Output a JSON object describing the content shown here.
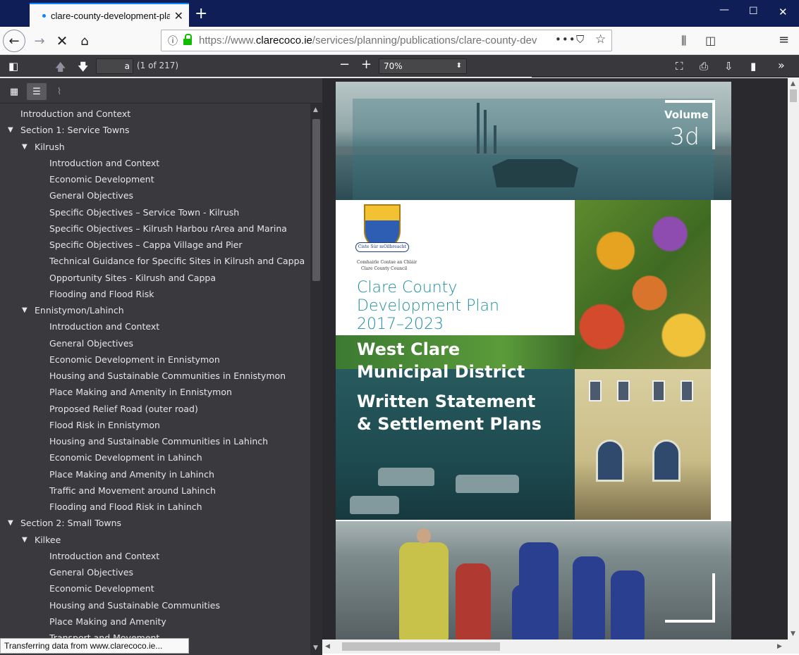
{
  "browser": {
    "tab_title": "clare-county-development-plan",
    "url_host_prefix": "https://www.",
    "url_host": "clarecoco.ie",
    "url_path": "/services/planning/publications/clare-county-devel",
    "status_text": "Transferring data from www.clarecoco.ie..."
  },
  "pdf_toolbar": {
    "page_value": "a",
    "page_count": "(1 of 217)",
    "zoom": "70%"
  },
  "outline": [
    {
      "label": "Introduction and Context",
      "level": 0,
      "toggle": false
    },
    {
      "label": "Section 1: Service Towns",
      "level": 0,
      "toggle": true
    },
    {
      "label": "Kilrush",
      "level": 1,
      "toggle": true
    },
    {
      "label": "Introduction and Context",
      "level": 2,
      "toggle": false
    },
    {
      "label": "Economic Development",
      "level": 2,
      "toggle": false
    },
    {
      "label": "General Objectives",
      "level": 2,
      "toggle": false
    },
    {
      "label": "Specific Objectives – Service Town - Kilrush",
      "level": 2,
      "toggle": false
    },
    {
      "label": "Specific Objectives – Kilrush Harbou rArea and Marina",
      "level": 2,
      "toggle": false
    },
    {
      "label": "Specific Objectives – Cappa Village and Pier",
      "level": 2,
      "toggle": false
    },
    {
      "label": "Technical Guidance for Specific Sites in Kilrush and Cappa",
      "level": 2,
      "toggle": false
    },
    {
      "label": "Opportunity Sites - Kilrush and Cappa",
      "level": 2,
      "toggle": false
    },
    {
      "label": "Flooding and Flood Risk",
      "level": 2,
      "toggle": false
    },
    {
      "label": "Ennistymon/Lahinch",
      "level": 1,
      "toggle": true
    },
    {
      "label": "Introduction and Context",
      "level": 2,
      "toggle": false
    },
    {
      "label": "General Objectives",
      "level": 2,
      "toggle": false
    },
    {
      "label": "Economic Development in Ennistymon",
      "level": 2,
      "toggle": false
    },
    {
      "label": "Housing and Sustainable Communities in Ennistymon",
      "level": 2,
      "toggle": false
    },
    {
      "label": "Place Making and Amenity in Ennistymon",
      "level": 2,
      "toggle": false
    },
    {
      "label": "Proposed Relief Road (outer road)",
      "level": 2,
      "toggle": false
    },
    {
      "label": "Flood Risk in Ennistymon",
      "level": 2,
      "toggle": false
    },
    {
      "label": "Housing and Sustainable Communities in Lahinch",
      "level": 2,
      "toggle": false
    },
    {
      "label": "Economic Development in Lahinch",
      "level": 2,
      "toggle": false
    },
    {
      "label": "Place Making and Amenity in Lahinch",
      "level": 2,
      "toggle": false
    },
    {
      "label": "Traffic and Movement around Lahinch",
      "level": 2,
      "toggle": false
    },
    {
      "label": "Flooding and Flood Risk in Lahinch",
      "level": 2,
      "toggle": false
    },
    {
      "label": "Section 2: Small Towns",
      "level": 0,
      "toggle": true
    },
    {
      "label": "Kilkee",
      "level": 1,
      "toggle": true
    },
    {
      "label": "Introduction and Context",
      "level": 2,
      "toggle": false
    },
    {
      "label": "General Objectives",
      "level": 2,
      "toggle": false
    },
    {
      "label": "Economic Development",
      "level": 2,
      "toggle": false
    },
    {
      "label": "Housing and Sustainable Communities",
      "level": 2,
      "toggle": false
    },
    {
      "label": "Place Making and Amenity",
      "level": 2,
      "toggle": false
    },
    {
      "label": "Transport and Movement",
      "level": 2,
      "toggle": false
    }
  ],
  "cover": {
    "volume_label": "Volume",
    "volume_number": "3d",
    "crest_motto": "Ciste Súr mOilbreacht",
    "council_irish": "Comhairle Contae an Chláir",
    "council_english": "Clare County Council",
    "plan_line1": "Clare County",
    "plan_line2": "Development Plan",
    "plan_line3": "2017–2023",
    "district_line1": "West Clare",
    "district_line2": "Municipal District",
    "statement_line1": "Written Statement",
    "statement_line2": "& Settlement Plans"
  },
  "colors": {
    "titlebar": "#0f1e57",
    "accent": "#0a84ff",
    "sidebar_bg": "#3a3a3e",
    "cover_teal": "#1c8fa0"
  }
}
